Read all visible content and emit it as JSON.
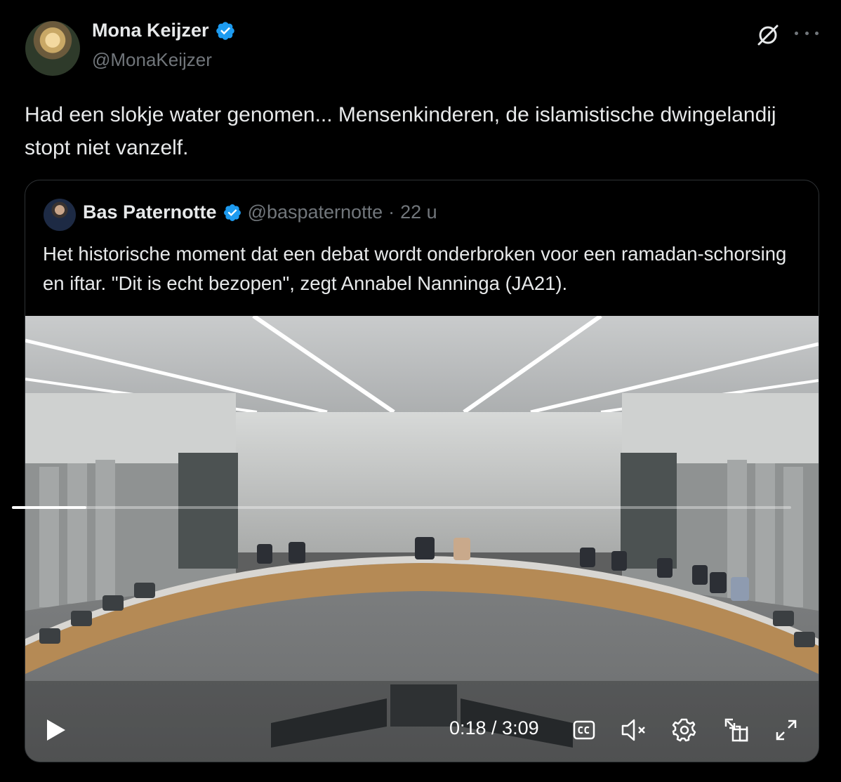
{
  "author": {
    "name": "Mona Keijzer",
    "handle": "@MonaKeijzer",
    "verified_color": "#1d9bf0"
  },
  "tweet": {
    "text": "Had een slokje water genomen... Mensenkinderen, de islamistische dwingelandij stopt niet vanzelf."
  },
  "quoted": {
    "name": "Bas Paternotte",
    "handle": "@baspaternotte",
    "separator": "·",
    "time": "22 u",
    "text": "Het historische moment dat een debat wordt onderbroken voor een ramadan-schorsing en iftar. \"Dit is echt bezopen\", zegt Annabel Nanninga (JA21)."
  },
  "video": {
    "time_display": "0:18 / 3:09",
    "progress": 0.0952,
    "controls": [
      "play-icon",
      "captions-icon",
      "mute-icon",
      "settings-icon",
      "pip-icon",
      "fullscreen-icon"
    ]
  },
  "icons": {
    "grok": "grok-icon",
    "more": "more-icon"
  }
}
